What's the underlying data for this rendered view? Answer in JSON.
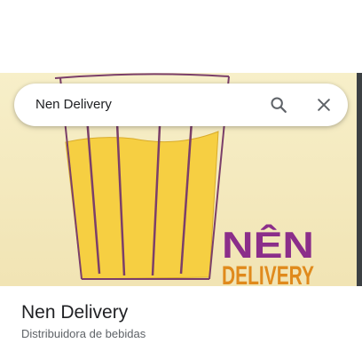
{
  "search": {
    "query": "Nen Delivery"
  },
  "hero": {
    "logo_line1": "NÊN",
    "logo_line2": "DELIVERY",
    "colors": {
      "background": "#f4ecc4",
      "cup_fill": "#f6cf42",
      "cup_stroke": "#7b3f6a",
      "logo_purple": "#8b2e8a",
      "logo_orange": "#e08a1c"
    }
  },
  "place": {
    "name": "Nen Delivery",
    "category": "Distribuidora de bebidas"
  },
  "icons": {
    "search": "search-icon",
    "close": "close-icon"
  }
}
